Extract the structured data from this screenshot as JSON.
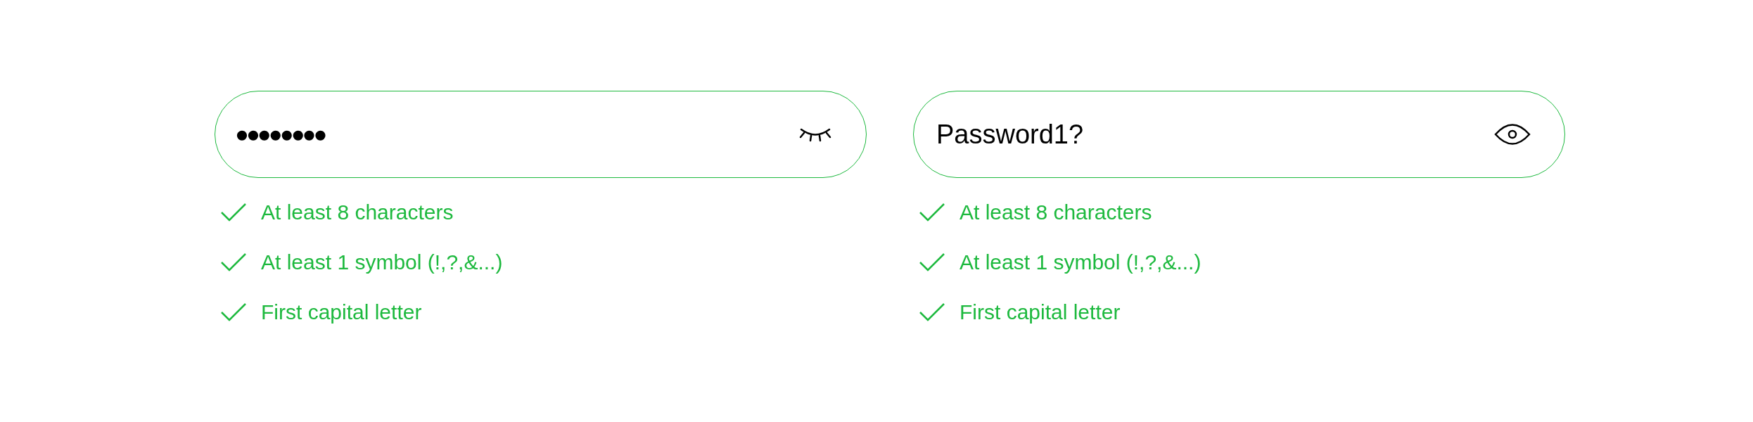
{
  "panels": [
    {
      "field": {
        "value": "●●●●●●●●",
        "revealed": false
      },
      "rules": [
        {
          "label": "At least 8 characters",
          "met": true
        },
        {
          "label": "At least 1 symbol (!,?,&...)",
          "met": true
        },
        {
          "label": "First capital letter",
          "met": true
        }
      ]
    },
    {
      "field": {
        "value": "Password1?",
        "revealed": true
      },
      "rules": [
        {
          "label": "At least 8 characters",
          "met": true
        },
        {
          "label": "At least 1 symbol (!,?,&...)",
          "met": true
        },
        {
          "label": "First capital letter",
          "met": true
        }
      ]
    }
  ]
}
